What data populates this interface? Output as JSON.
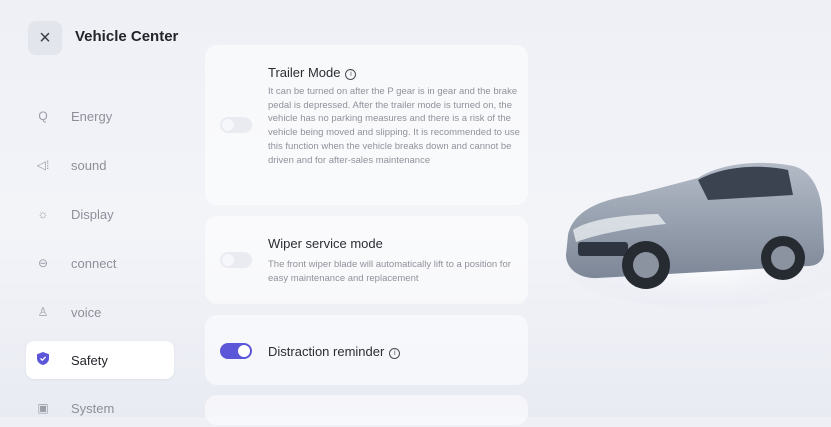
{
  "header": {
    "title": "Vehicle Center",
    "close_icon": "×"
  },
  "sidebar": {
    "items": [
      {
        "label": "Energy",
        "icon": "Q"
      },
      {
        "label": "sound",
        "icon": "◁⁞"
      },
      {
        "label": "Display",
        "icon": "☼"
      },
      {
        "label": "connect",
        "icon": "⊖"
      },
      {
        "label": "voice",
        "icon": "♙"
      },
      {
        "label": "Safety",
        "icon": "⛉",
        "active": true
      },
      {
        "label": "System",
        "icon": "▣"
      }
    ]
  },
  "cards": [
    {
      "title": "Trailer Mode",
      "toggle": "off",
      "description": "It can be turned on after the P gear is in gear and the brake pedal is depressed. After the trailer mode is turned on, the vehicle has no parking measures and there is a risk of the vehicle being moved and slipping. It is recommended to use this function when the vehicle breaks down and cannot be driven and for after-sales maintenance"
    },
    {
      "title": "Wiper service mode",
      "toggle": "off",
      "description": "The front wiper blade will automatically lift to a position for easy maintenance and replacement"
    },
    {
      "title": "Distraction reminder",
      "toggle": "on"
    }
  ],
  "colors": {
    "accent": "#5b57d8",
    "background": "#eef0f6",
    "car_body": "#8e99a8"
  },
  "info_icon": "i"
}
